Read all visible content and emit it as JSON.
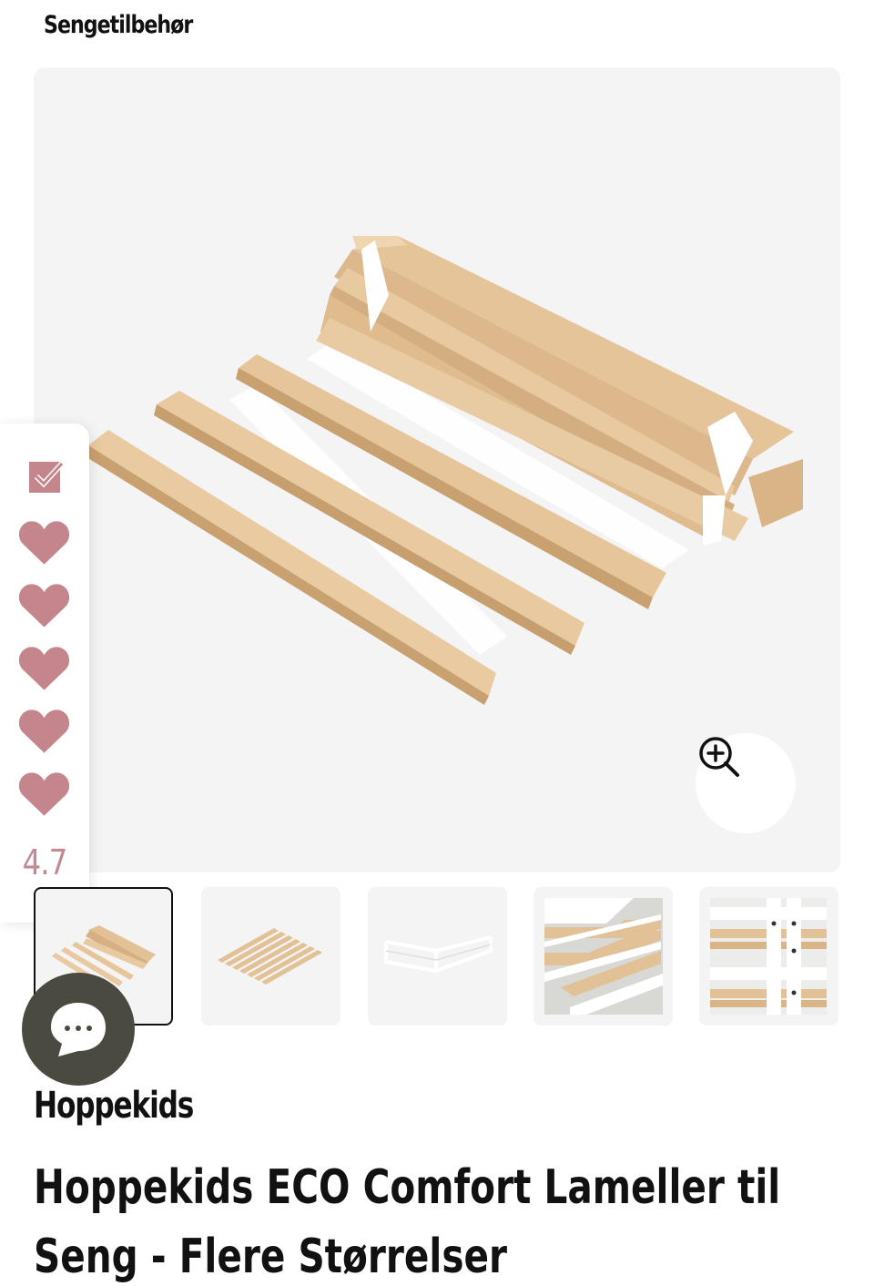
{
  "breadcrumb": {
    "label": "Sengetilbehør"
  },
  "product": {
    "brand": "Hoppekids",
    "title": "Hoppekids ECO Comfort Lameller til Seng - Flere Størrelser",
    "main_image_alt": "Hoppekids ECO Comfort Lameller"
  },
  "rating": {
    "value": "4.7",
    "filled_hearts": 5,
    "max_hearts": 5,
    "heart_color": "#c4858c"
  },
  "gallery": {
    "thumbnails": [
      {
        "alt": "lameller rullet sammen",
        "active": true
      },
      {
        "alt": "lameller udrullet",
        "active": false
      },
      {
        "alt": "hvid seng med lameller",
        "active": false
      },
      {
        "alt": "hvid seng detalje",
        "active": false
      },
      {
        "alt": "køjeseng med lameller",
        "active": false
      }
    ]
  },
  "icons": {
    "zoom": "zoom-in-icon",
    "chat": "chat-bubble-icon",
    "rating_check": "checkbox-icon"
  },
  "colors": {
    "accent_pink": "#c4858c",
    "chat_button": "#4a4a40",
    "image_bg": "#f4f4f4",
    "wood": "#e8c9a0"
  }
}
